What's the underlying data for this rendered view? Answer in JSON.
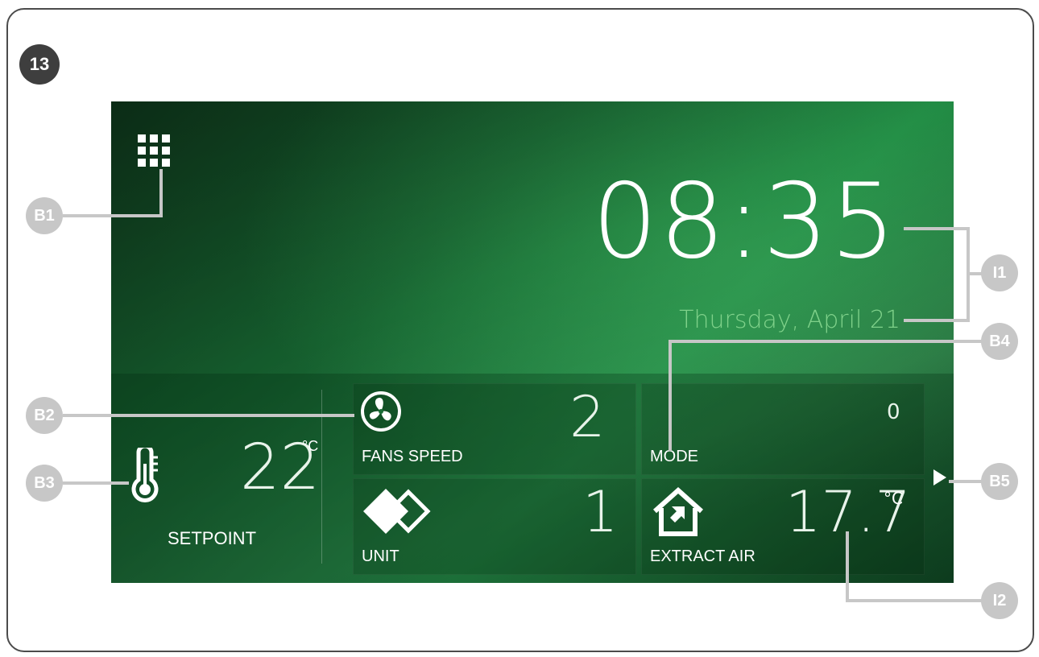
{
  "figure_number": "13",
  "clock": {
    "time": "08:35",
    "date": "Thursday, April 21"
  },
  "setpoint": {
    "value": "22",
    "unit": "°C",
    "label": "SETPOINT",
    "icon": "thermometer-icon"
  },
  "tiles": {
    "fans_speed": {
      "label": "FANS SPEED",
      "value": "2",
      "icon": "fan-icon"
    },
    "mode": {
      "label": "MODE",
      "value": "0"
    },
    "unit": {
      "label": "UNIT",
      "value": "1",
      "icon": "diamonds-icon"
    },
    "extract_air": {
      "label": "EXTRACT AIR",
      "value": "17.7",
      "unit": "°C",
      "icon": "house-icon"
    }
  },
  "menu_icon": "grid-menu-icon",
  "next_icon": "play-arrow-icon",
  "callouts": {
    "b1": "B1",
    "b2": "B2",
    "b3": "B3",
    "b4": "B4",
    "b5": "B5",
    "i1": "I1",
    "i2": "I2"
  },
  "colors": {
    "screen_green": "#1b6e36",
    "date_green": "#7fd18a",
    "callout_grey": "#c7c7c7",
    "badge_dark": "#3e3e3e"
  }
}
